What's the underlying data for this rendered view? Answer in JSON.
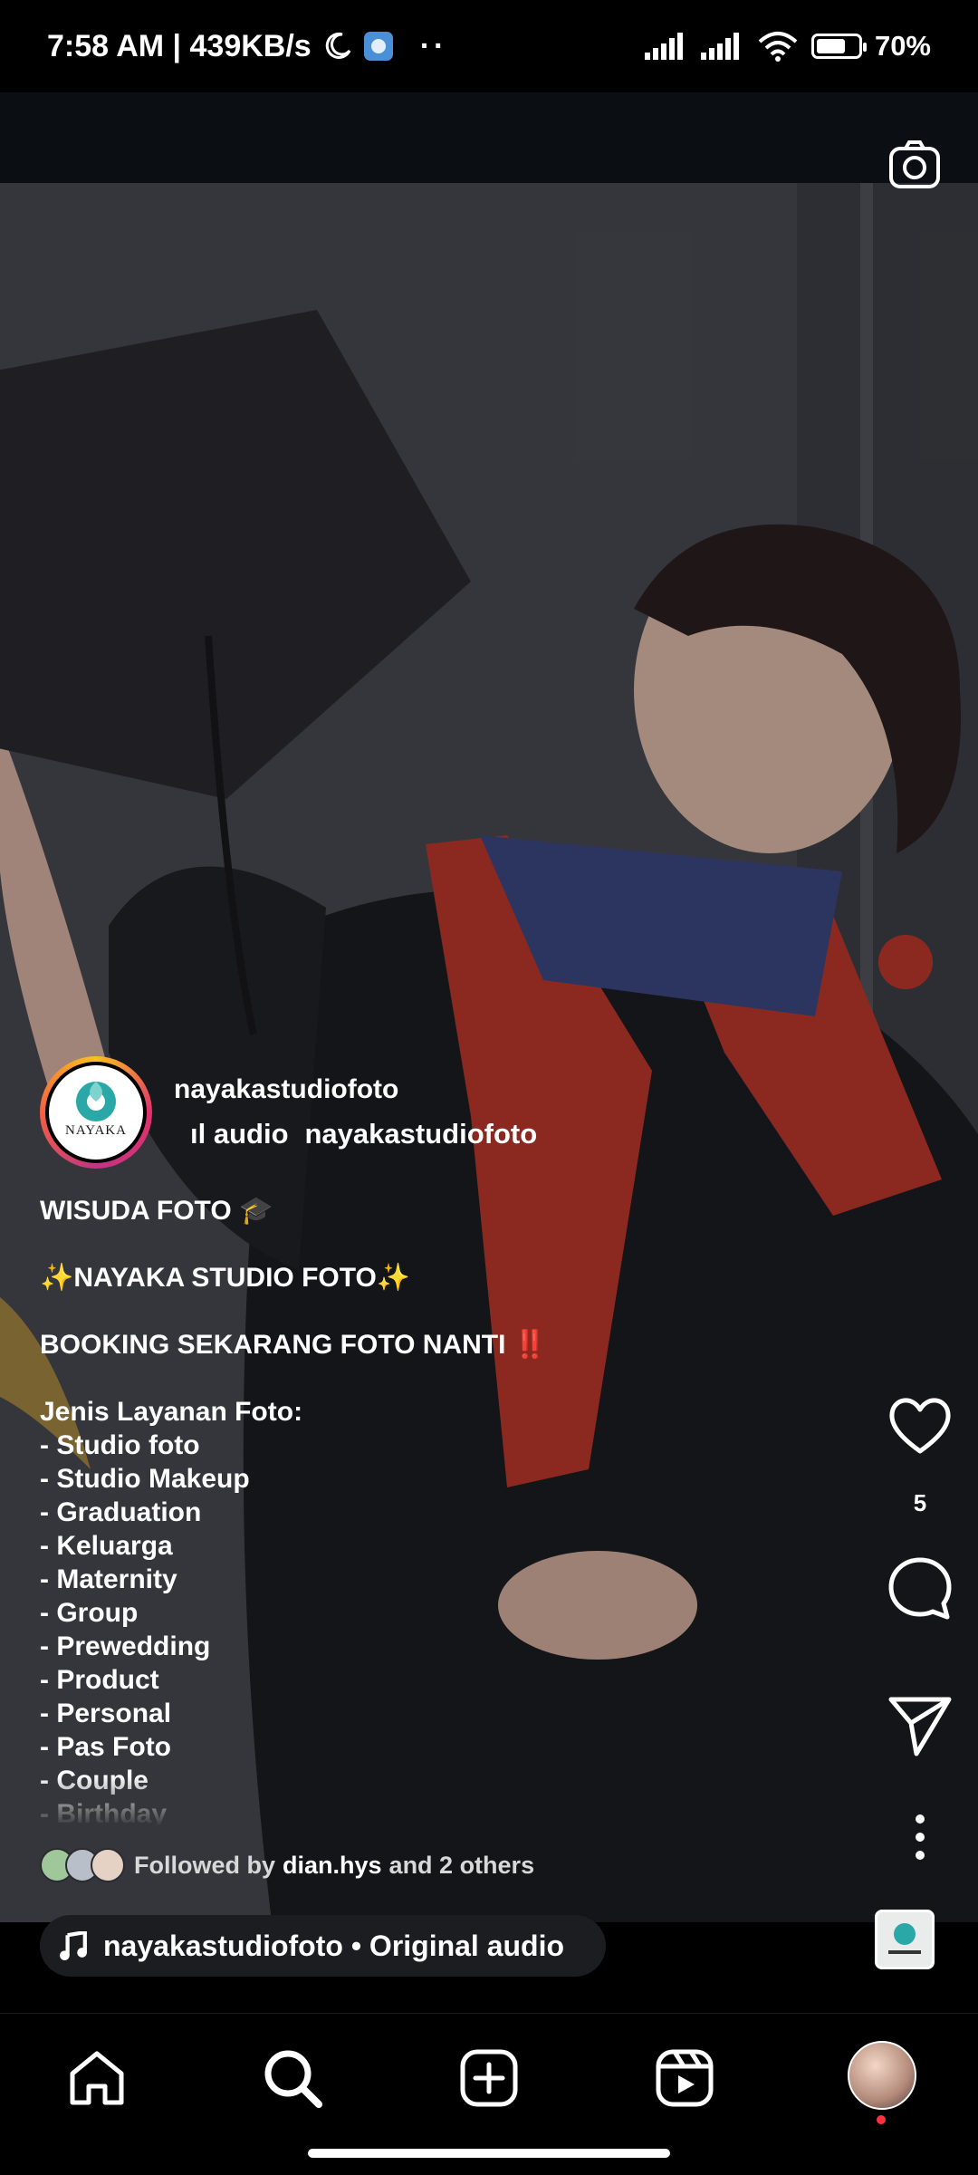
{
  "status_bar": {
    "time": "7:58 AM | 439KB/s",
    "battery": "70%",
    "battery_level": 0.7
  },
  "post": {
    "author": "nayakastudiofoto",
    "audio_snippet": "ıl audio",
    "audio_author": "nayakastudiofoto",
    "logo_text": "NAYAKA",
    "caption_lines": [
      "WISUDA FOTO 🎓",
      "",
      "✨NAYAKA STUDIO FOTO✨",
      "",
      "BOOKING SEKARANG FOTO NANTI ‼️",
      "",
      "Jenis Layanan Foto:",
      "- Studio foto",
      "- Studio Makeup",
      "- Graduation",
      "- Keluarga",
      "- Maternity",
      "- Group",
      "- Prewedding",
      "- Product",
      "- Personal",
      "- Pas Foto",
      "- Couple",
      "- Birthday"
    ],
    "followed_prefix": "Followed by",
    "followed_user": "dian.hys",
    "followed_suffix": "and 2 others",
    "like_count": "5",
    "audio_pill": "nayakastudiofoto • Original audio"
  },
  "icons": {
    "camera": "camera-icon",
    "like": "heart-icon",
    "comment": "comment-icon",
    "share": "send-icon",
    "more": "more-vertical-icon",
    "music": "music-note-icon",
    "nav": [
      "home-icon",
      "search-icon",
      "add-icon",
      "reels-icon",
      "profile-avatar"
    ]
  },
  "colors": {
    "status_bar": "#000000",
    "top_bar": "#0b0f14",
    "pill_bg": "#1c1d20",
    "notification_dot": "#ff3040"
  }
}
